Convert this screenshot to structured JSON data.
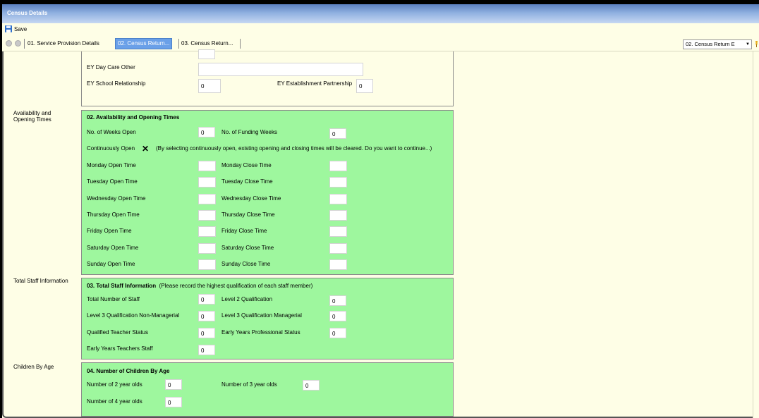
{
  "window": {
    "title": "Census Details"
  },
  "toolbar": {
    "save_label": "Save"
  },
  "tabs": [
    {
      "label": "01. Service Provision Details"
    },
    {
      "label": "02. Census Return..."
    },
    {
      "label": "03. Census Return..."
    }
  ],
  "tab_select": {
    "value": "02. Census Return E"
  },
  "section0": {
    "ey_day_care_other_label": "EY Day Care Other",
    "ey_day_care_other_value": "",
    "ey_school_relationship_label": "EY School Relationship",
    "ey_school_relationship_value": "0",
    "ey_establishment_partnership_label": "EY Establishment Partnership",
    "ey_establishment_partnership_value": "0"
  },
  "section_labels": {
    "availability": "Availability and Opening Times",
    "staff": "Total Staff Information",
    "children": "Children By Age"
  },
  "availability": {
    "title": "02. Availability and Opening Times",
    "weeks_open_label": "No. of Weeks Open",
    "weeks_open_value": "0",
    "funding_weeks_label": "No. of Funding Weeks",
    "funding_weeks_value": "0",
    "continuously_open_label": "Continuously Open",
    "continuously_open_mark": "✕",
    "continuously_open_note": "(By selecting continuously open, existing opening and closing times will be cleared. Do you want to continue...)",
    "days": [
      {
        "open_label": "Monday Open Time",
        "close_label": "Monday Close Time"
      },
      {
        "open_label": "Tuesday Open Time",
        "close_label": "Tuesday Close Time"
      },
      {
        "open_label": "Wednesday Open Time",
        "close_label": "Wednesday Close Time"
      },
      {
        "open_label": "Thursday Open Time",
        "close_label": "Thursday Close Time"
      },
      {
        "open_label": "Friday Open Time",
        "close_label": "Friday Close Time"
      },
      {
        "open_label": "Saturday Open Time",
        "close_label": "Saturday Close Time"
      },
      {
        "open_label": "Sunday Open Time",
        "close_label": "Sunday Close Time"
      }
    ]
  },
  "staff": {
    "title": "03. Total Staff Information",
    "title_note": "(Please record the highest qualification of each staff member)",
    "total_label": "Total Number of Staff",
    "total_value": "0",
    "level2_label": "Level 2 Qualification",
    "level2_value": "0",
    "level3_nm_label": "Level 3 Qualification Non-Managerial",
    "level3_nm_value": "0",
    "level3_m_label": "Level 3 Qualification Managerial",
    "level3_m_value": "0",
    "qts_label": "Qualified Teacher Status",
    "qts_value": "0",
    "eyps_label": "Early Years Professional Status",
    "eyps_value": "0",
    "eyts_label": "Early Years Teachers Staff",
    "eyts_value": "0"
  },
  "children": {
    "title": "04. Number of Children By Age",
    "two_label": "Number of 2 year olds",
    "two_value": "0",
    "three_label": "Number of 3 year olds",
    "three_value": "0",
    "four_label": "Number of 4 year olds",
    "four_value": "0"
  },
  "colors": {
    "panel_green": "#9ef79e",
    "background": "#fefee6",
    "active_tab": "#6aa0e8"
  }
}
